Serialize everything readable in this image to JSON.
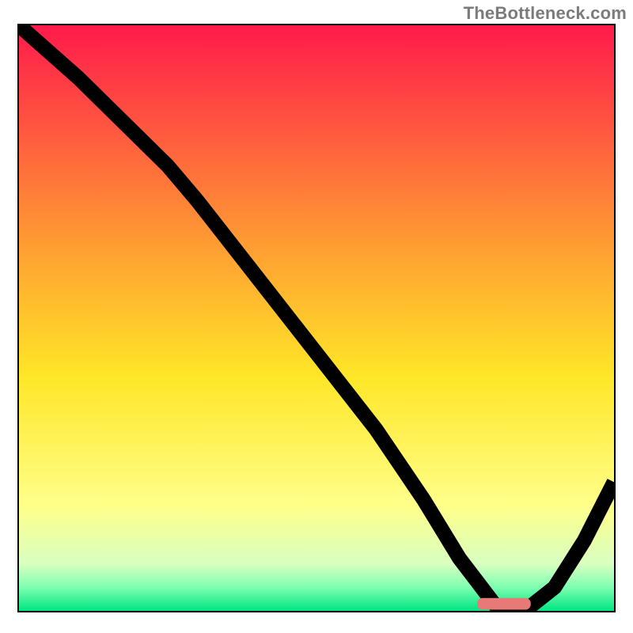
{
  "watermark": "TheBottleneck.com",
  "chart_data": {
    "type": "line",
    "title": "",
    "xlabel": "",
    "ylabel": "",
    "xlim": [
      0,
      100
    ],
    "ylim": [
      0,
      100
    ],
    "grid": false,
    "legend": false,
    "background": {
      "type": "vertical-gradient",
      "stops": [
        {
          "pos": 0.0,
          "color": "#ff1a4b"
        },
        {
          "pos": 0.4,
          "color": "#ffa531"
        },
        {
          "pos": 0.6,
          "color": "#ffe627"
        },
        {
          "pos": 0.82,
          "color": "#ffff8a"
        },
        {
          "pos": 0.92,
          "color": "#d8ffc0"
        },
        {
          "pos": 0.96,
          "color": "#7dffb0"
        },
        {
          "pos": 1.0,
          "color": "#00e582"
        }
      ]
    },
    "series": [
      {
        "name": "bottleneck-curve",
        "x": [
          0,
          10,
          20,
          25,
          30,
          40,
          50,
          60,
          68,
          74,
          80,
          85,
          90,
          95,
          100
        ],
        "y": [
          100,
          91,
          81,
          76,
          70,
          57,
          44,
          31,
          19,
          9,
          1,
          0,
          4,
          12,
          22
        ]
      }
    ],
    "annotations": [
      {
        "name": "optimal-range-marker",
        "shape": "rounded-rect",
        "x_range": [
          77,
          86
        ],
        "y": 1.2,
        "color": "#e77a77"
      }
    ]
  }
}
